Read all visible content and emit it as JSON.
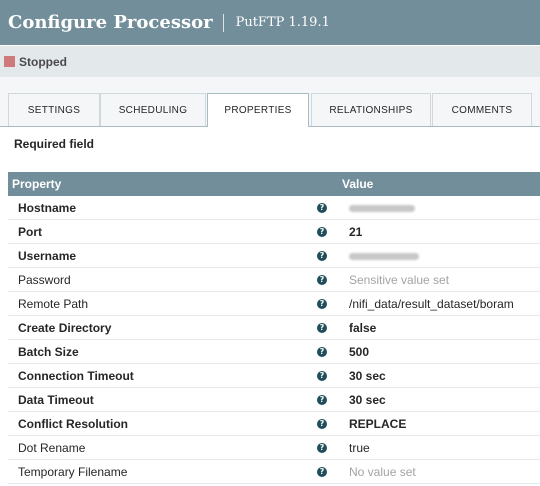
{
  "header": {
    "title": "Configure Processor",
    "subtitle": "PutFTP 1.19.1"
  },
  "status": {
    "label": "Stopped",
    "color": "#ce7a7b"
  },
  "tabs": [
    {
      "label": "SETTINGS"
    },
    {
      "label": "SCHEDULING"
    },
    {
      "label": "PROPERTIES",
      "active": true
    },
    {
      "label": "RELATIONSHIPS"
    },
    {
      "label": "COMMENTS"
    }
  ],
  "required_label": "Required field",
  "table": {
    "columns": [
      "Property",
      "Value"
    ],
    "rows": [
      {
        "name": "Hostname",
        "value": "",
        "required": true,
        "redacted": true
      },
      {
        "name": "Port",
        "value": "21",
        "required": true
      },
      {
        "name": "Username",
        "value": "",
        "required": true,
        "redacted": true
      },
      {
        "name": "Password",
        "value": "Sensitive value set",
        "required": false,
        "muted": true
      },
      {
        "name": "Remote Path",
        "value": "/nifi_data/result_dataset/boram",
        "required": false
      },
      {
        "name": "Create Directory",
        "value": "false",
        "required": true
      },
      {
        "name": "Batch Size",
        "value": "500",
        "required": true
      },
      {
        "name": "Connection Timeout",
        "value": "30 sec",
        "required": true
      },
      {
        "name": "Data Timeout",
        "value": "30 sec",
        "required": true
      },
      {
        "name": "Conflict Resolution",
        "value": "REPLACE",
        "required": true
      },
      {
        "name": "Dot Rename",
        "value": "true",
        "required": false
      },
      {
        "name": "Temporary Filename",
        "value": "No value set",
        "required": false,
        "muted": true
      }
    ]
  },
  "help_icon": "question-circle-icon"
}
